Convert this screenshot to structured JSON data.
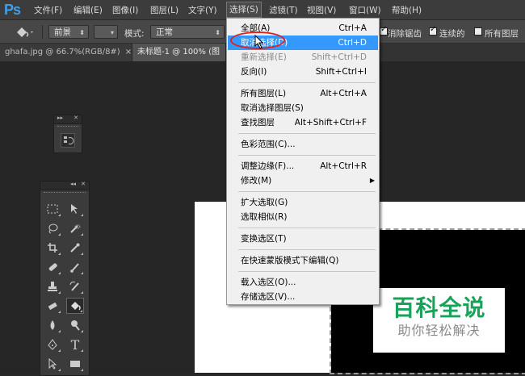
{
  "app": {
    "logo": "Ps"
  },
  "menubar": {
    "items": [
      "文件(F)",
      "编辑(E)",
      "图像(I)",
      "图层(L)",
      "文字(Y)",
      "选择(S)",
      "滤镜(T)",
      "视图(V)",
      "窗口(W)",
      "帮助(H)"
    ]
  },
  "options": {
    "fill_source": "前景",
    "mode_label": "模式:",
    "mode_value": "正常",
    "antialias": "消除锯齿",
    "contiguous": "连续的",
    "all_layers": "所有图层"
  },
  "tabs": [
    {
      "label": "ghafa.jpg @ 66.7%(RGB/8#)",
      "close": "×"
    },
    {
      "label": "未标题-1 @ 100% (图"
    }
  ],
  "select_menu": {
    "items": [
      {
        "label": "全部(A)",
        "shortcut": "Ctrl+A"
      },
      {
        "label": "取消选择(D)",
        "shortcut": "Ctrl+D",
        "highlighted": true
      },
      {
        "label": "重新选择(E)",
        "shortcut": "Shift+Ctrl+D",
        "disabled": true
      },
      {
        "label": "反向(I)",
        "shortcut": "Shift+Ctrl+I"
      },
      {
        "label": "所有图层(L)",
        "shortcut": "Alt+Ctrl+A"
      },
      {
        "label": "取消选择图层(S)",
        "shortcut": ""
      },
      {
        "label": "查找图层",
        "shortcut": "Alt+Shift+Ctrl+F"
      },
      {
        "label": "色彩范围(C)...",
        "shortcut": ""
      },
      {
        "label": "调整边缘(F)...",
        "shortcut": "Alt+Ctrl+R"
      },
      {
        "label": "修改(M)",
        "shortcut": "",
        "submenu": true
      },
      {
        "label": "扩大选取(G)",
        "shortcut": ""
      },
      {
        "label": "选取相似(R)",
        "shortcut": ""
      },
      {
        "label": "变换选区(T)",
        "shortcut": ""
      },
      {
        "label": "在快速蒙版模式下编辑(Q)",
        "shortcut": ""
      },
      {
        "label": "载入选区(O)...",
        "shortcut": ""
      },
      {
        "label": "存储选区(V)...",
        "shortcut": ""
      }
    ]
  },
  "watermark": {
    "title": "百科全说",
    "subtitle": "助你轻松解决"
  },
  "colors": {
    "accent": "#3399ff",
    "brand": "#19a35a",
    "ring": "#e02020"
  }
}
